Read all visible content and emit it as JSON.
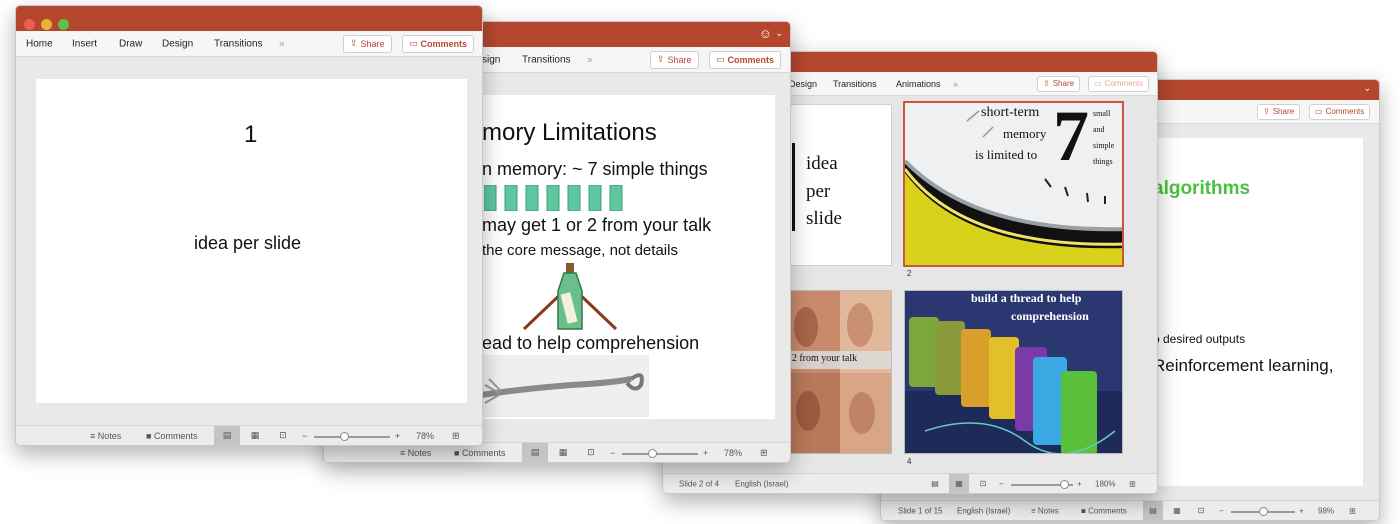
{
  "colors": {
    "titlebar": "#b6472f",
    "accent_green": "#4bbf3f",
    "bar_green": "#5fc7a0"
  },
  "win4": {
    "ribbon": {
      "tab_fragment": "s"
    },
    "share": "Share",
    "comments": "Comments",
    "slide": {
      "heading": "algorithms",
      "line1": "o desired outputs",
      "line2": "Reinforcement learning,"
    },
    "status": {
      "slide_info": "Slide 1 of 15",
      "language": "English (Israel)",
      "notes": "Notes",
      "comments": "Comments",
      "zoom": "98%"
    }
  },
  "win3": {
    "ribbon": {
      "tabs": [
        "Design",
        "Transitions",
        "Animations"
      ]
    },
    "share": "Share",
    "comments": "Comments",
    "thumbs": {
      "t1": {
        "lines": [
          "idea",
          "per",
          "slide"
        ]
      },
      "t2": {
        "number": "2",
        "words": [
          "short-term",
          "memory",
          "is limited to"
        ],
        "big": "7",
        "small": [
          "small",
          "and",
          "simple",
          "things"
        ]
      },
      "t3": {
        "caption": "r 2 from your talk"
      },
      "t4": {
        "number": "4",
        "title_line1": "build a thread to help",
        "title_line2": "comprehension"
      }
    },
    "status": {
      "slide_info": "Slide 2 of 4",
      "language": "English (Israel)",
      "zoom": "180%"
    }
  },
  "win2": {
    "ribbon": {
      "tabs": [
        "sign",
        "Transitions"
      ]
    },
    "share": "Share",
    "comments": "Comments",
    "slide": {
      "title": "mory Limitations",
      "line1": "n memory: ~ 7 simple things",
      "line2": "may get 1 or 2 from your talk",
      "line3": "the core message, not details",
      "line4": "ead to help comprehension"
    },
    "status": {
      "notes": "Notes",
      "comments": "Comments",
      "zoom": "78%"
    }
  },
  "win1": {
    "ribbon": {
      "tabs": [
        "Home",
        "Insert",
        "Draw",
        "Design",
        "Transitions"
      ]
    },
    "share": "Share",
    "comments": "Comments",
    "slide": {
      "number": "1",
      "text": "idea per slide"
    },
    "status": {
      "notes": "Notes",
      "comments": "Comments",
      "zoom": "78%"
    }
  }
}
